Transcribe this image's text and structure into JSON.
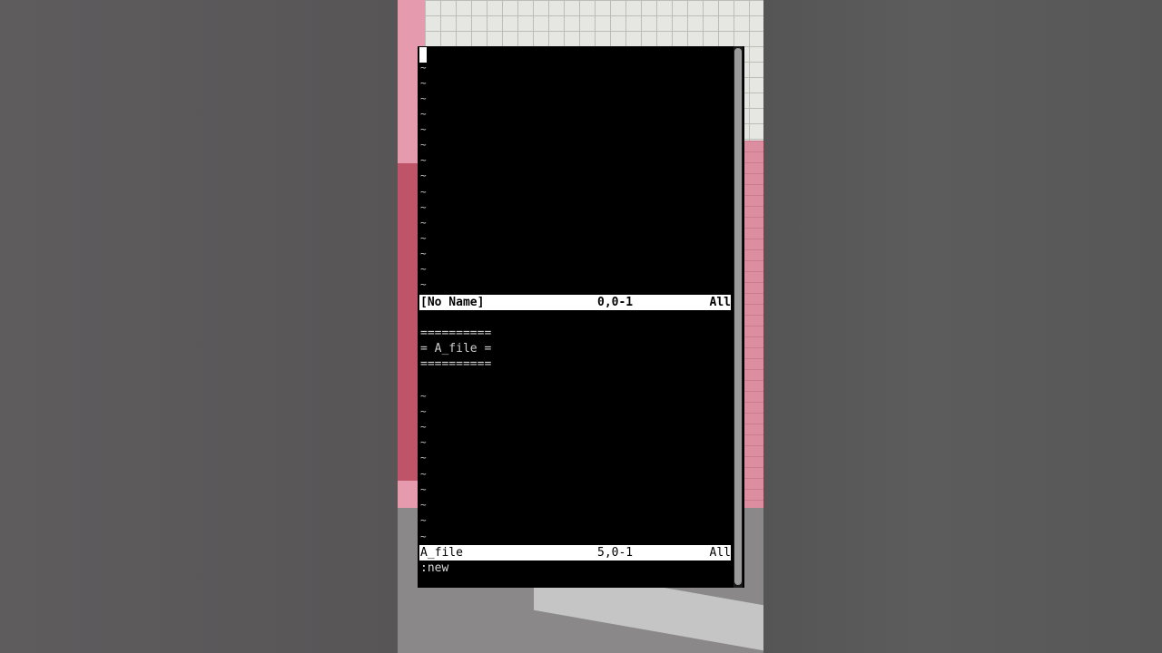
{
  "top_window": {
    "tildes": [
      "~",
      "~",
      "~",
      "~",
      "~",
      "~",
      "~",
      "~",
      "~",
      "~",
      "~",
      "~",
      "~",
      "~",
      "~"
    ],
    "status": {
      "name": "[No Name]",
      "position": "0,0-1",
      "scroll": "All"
    }
  },
  "bottom_window": {
    "lines": [
      "",
      "==========",
      "= A_file =",
      "==========",
      ""
    ],
    "tildes": [
      "~",
      "~",
      "~",
      "~",
      "~",
      "~",
      "~",
      "~",
      "~",
      "~"
    ],
    "status": {
      "name": "A_file",
      "position": "5,0-1",
      "scroll": "All"
    }
  },
  "command_line": ":new"
}
